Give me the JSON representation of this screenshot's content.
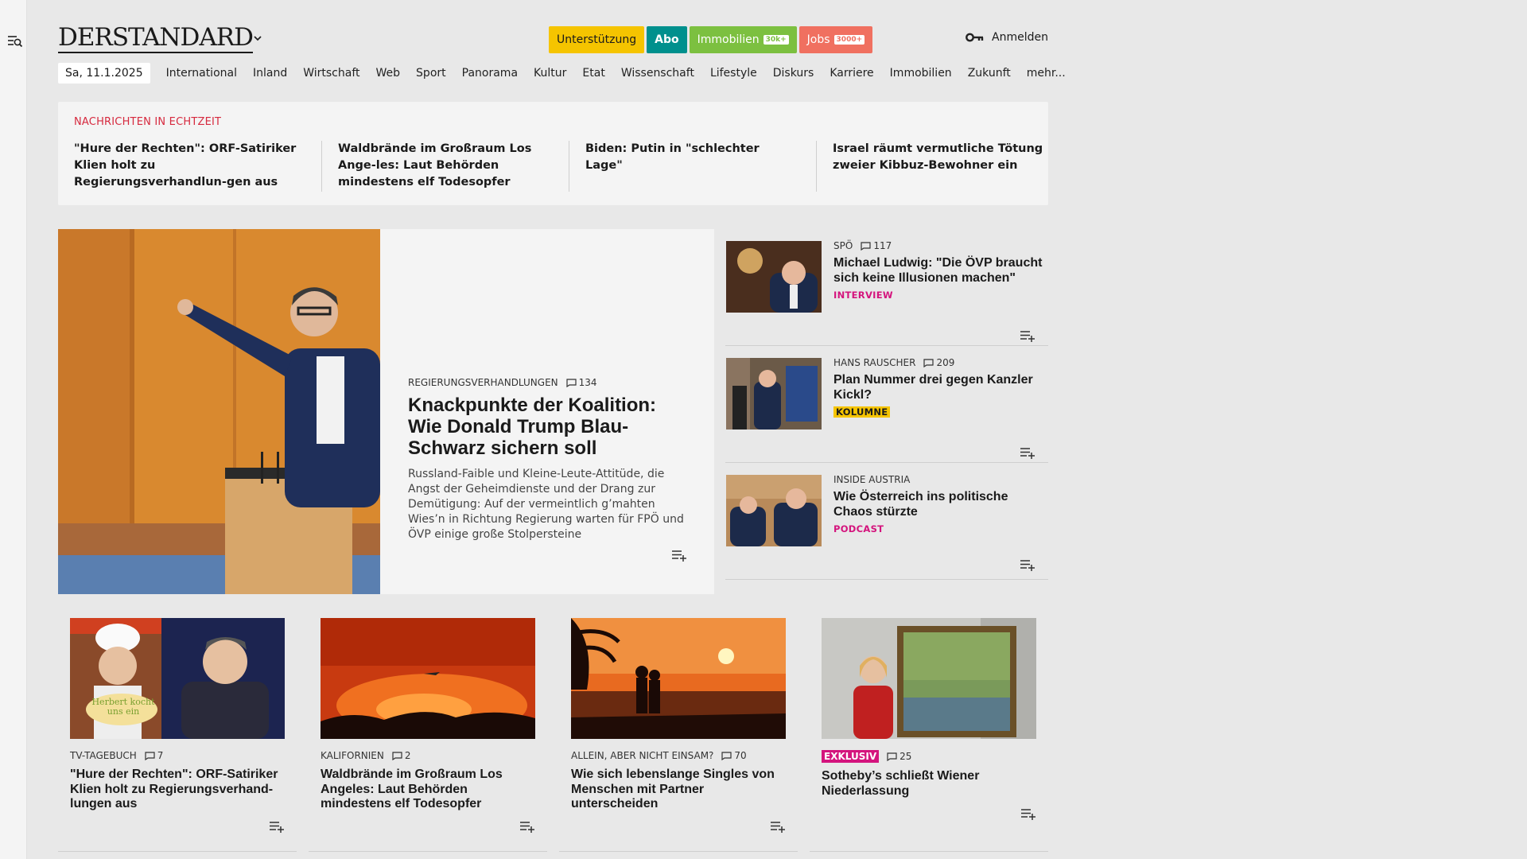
{
  "brand": {
    "logo": "DERSTANDARD"
  },
  "header_buttons": {
    "support": "Unterstützung",
    "abo": "Abo",
    "immobilien": "Immobilien",
    "immobilien_badge": "30k+",
    "jobs": "Jobs",
    "jobs_badge": "3000+"
  },
  "login_label": "Anmelden",
  "nav": {
    "date": "Sa, 11.1.2025",
    "items": [
      "International",
      "Inland",
      "Wirtschaft",
      "Web",
      "Sport",
      "Panorama",
      "Kultur",
      "Etat",
      "Wissenschaft",
      "Lifestyle",
      "Diskurs",
      "Karriere",
      "Immobilien",
      "Zukunft",
      "mehr..."
    ]
  },
  "ticker": {
    "label": "Nachrichten in Echtzeit",
    "items": [
      "\"Hure der Rechten\": ORF-Satiriker Klien holt zu Regierungsverhandlun-gen aus",
      "Waldbrände im Großraum Los Ange-les: Laut Behörden mindestens elf Todesopfer",
      "Biden: Putin in \"schlechter Lage\"",
      "Israel räumt vermutliche Tötung zweier Kibbuz-Bewohner ein"
    ]
  },
  "lead": {
    "kicker": "Regierungsverhandlungen",
    "comments": "134",
    "title": "Knackpunkte der Koalition: Wie Donald Trump Blau-Schwarz sichern soll",
    "subtitle": "Russland-Faible und Kleine-Leute-Attitüde, die Angst der Geheimdienste und der Drang zur Demütigung: Auf der vermeintlich g’mahten Wies’n in Richtung Regierung warten für FPÖ und ÖVP einige große Stolpersteine"
  },
  "side": [
    {
      "kicker": "SPÖ",
      "comments": "117",
      "title": "Michael Ludwig: \"Die ÖVP braucht sich keine Illusionen machen\"",
      "tag": "Interview"
    },
    {
      "kicker": "Hans Rauscher",
      "comments": "209",
      "title": "Plan Nummer drei gegen Kanzler Kickl?",
      "tag": "Kolumne"
    },
    {
      "kicker": "Inside Austria",
      "comments": "",
      "title": "Wie Österreich ins politische Chaos stürzte",
      "tag": "Podcast"
    }
  ],
  "cards": [
    {
      "kicker": "TV-Tagebuch",
      "comments": "7",
      "title": "\"Hure der Rechten\": ORF-Satiriker Klien holt zu Regierungsverhand-lungen aus",
      "img_caption": "Herbert kocht uns ein"
    },
    {
      "kicker": "Kalifornien",
      "comments": "2",
      "title": "Waldbrände im Großraum Los Angeles: Laut Behörden mindestens elf Todesopfer"
    },
    {
      "kicker": "Allein, aber nicht einsam?",
      "comments": "70",
      "title": "Wie sich lebenslange Singles von Menschen mit Partner unterscheiden"
    },
    {
      "kicker": "Exklusiv",
      "comments": "25",
      "title": "Sotheby’s schließt Wiener Niederlassung"
    }
  ],
  "colors": {
    "accent_red": "#d6293e",
    "tag_pink": "#d4147d",
    "support_yellow": "#f5c400",
    "abo_teal": "#00908d",
    "immo_green": "#7cc040",
    "jobs_salmon": "#f07060"
  },
  "icons": [
    "search-menu-icon",
    "chevron-down-icon",
    "key-icon",
    "comment-icon",
    "add-to-list-icon"
  ]
}
